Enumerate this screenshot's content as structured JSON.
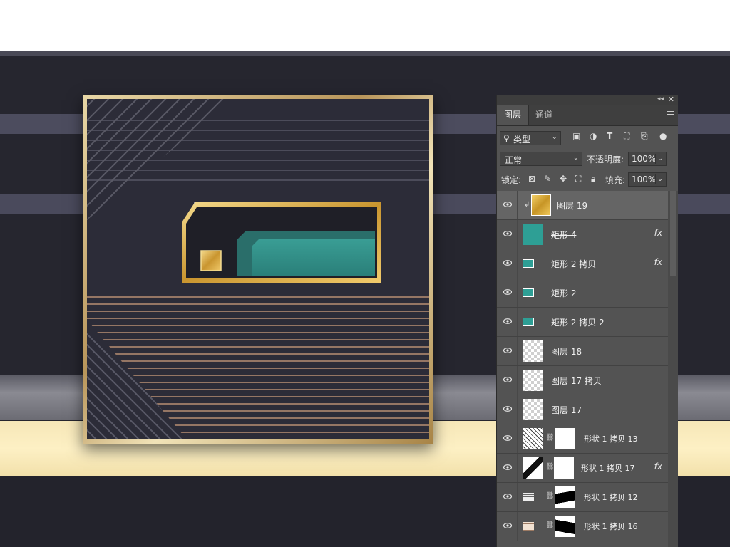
{
  "top": {
    "title_fragment": "·······"
  },
  "panel": {
    "tabs": [
      {
        "label": "图层"
      },
      {
        "label": "通道"
      }
    ],
    "filter": {
      "label": "类型"
    },
    "blend_mode": "正常",
    "opacity_label": "不透明度:",
    "opacity_value": "100%",
    "lock_label": "锁定:",
    "fill_label": "填充:",
    "fill_value": "100%",
    "layers": [
      {
        "name": "图层 19",
        "fx": ""
      },
      {
        "name": "矩形 4",
        "fx": "fx"
      },
      {
        "name": "矩形 2 拷贝",
        "fx": "fx"
      },
      {
        "name": "矩形 2",
        "fx": ""
      },
      {
        "name": "矩形 2 拷贝 2",
        "fx": ""
      },
      {
        "name": "图层 18",
        "fx": ""
      },
      {
        "name": "图层 17 拷贝",
        "fx": ""
      },
      {
        "name": "图层 17",
        "fx": ""
      },
      {
        "name": "形状 1 拷贝 13",
        "fx": ""
      },
      {
        "name": "形状 1 拷贝 17",
        "fx": "fx"
      },
      {
        "name": "形状 1 拷贝 12",
        "fx": ""
      },
      {
        "name": "形状 1 拷贝 16",
        "fx": ""
      }
    ]
  },
  "colors": {
    "teal": "#2e8d86",
    "gold": "#d4a23a",
    "panel_bg": "#535353",
    "cream": "#fdf0c4"
  }
}
